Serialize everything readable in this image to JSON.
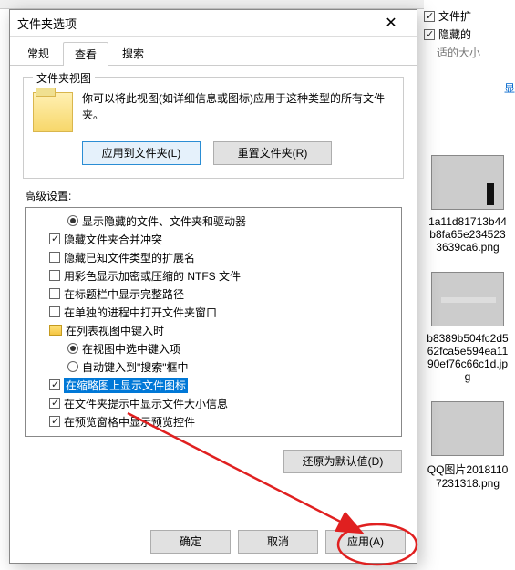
{
  "bg": {
    "opt1": "文件扩",
    "opt2": "隐藏的",
    "muted": "适的大小",
    "more": "显"
  },
  "thumbs": [
    {
      "name": "1a11d81713b44b8fa65e2345233639ca6.png"
    },
    {
      "name": "b8389b504fc2d562fca5e594ea1190ef76c66c1d.jpg"
    },
    {
      "name": "QQ图片20181107231318.png"
    }
  ],
  "dialog": {
    "title": "文件夹选项",
    "tabs": {
      "general": "常规",
      "view": "查看",
      "search": "搜索"
    },
    "folderView": {
      "legend": "文件夹视图",
      "desc": "你可以将此视图(如详细信息或图标)应用于这种类型的所有文件夹。",
      "applyBtn": "应用到文件夹(L)",
      "resetBtn": "重置文件夹(R)"
    },
    "advancedLabel": "高级设置:",
    "items": {
      "r_show_hidden": "显示隐藏的文件、文件夹和驱动器",
      "c_hide_merge": "隐藏文件夹合并冲突",
      "c_hide_ext": "隐藏已知文件类型的扩展名",
      "c_ntfs": "用彩色显示加密或压缩的 NTFS 文件",
      "c_fullpath": "在标题栏中显示完整路径",
      "c_sepproc": "在单独的进程中打开文件夹窗口",
      "f_listnav": "在列表视图中键入时",
      "r_select": "在视图中选中键入项",
      "r_search": "自动键入到\"搜索\"框中",
      "c_thumb": "在缩略图上显示文件图标",
      "c_tipsize": "在文件夹提示中显示文件大小信息",
      "c_preview": "在预览窗格中显示预览控件"
    },
    "restore": "还原为默认值(D)",
    "ok": "确定",
    "cancel": "取消",
    "apply": "应用(A)"
  }
}
